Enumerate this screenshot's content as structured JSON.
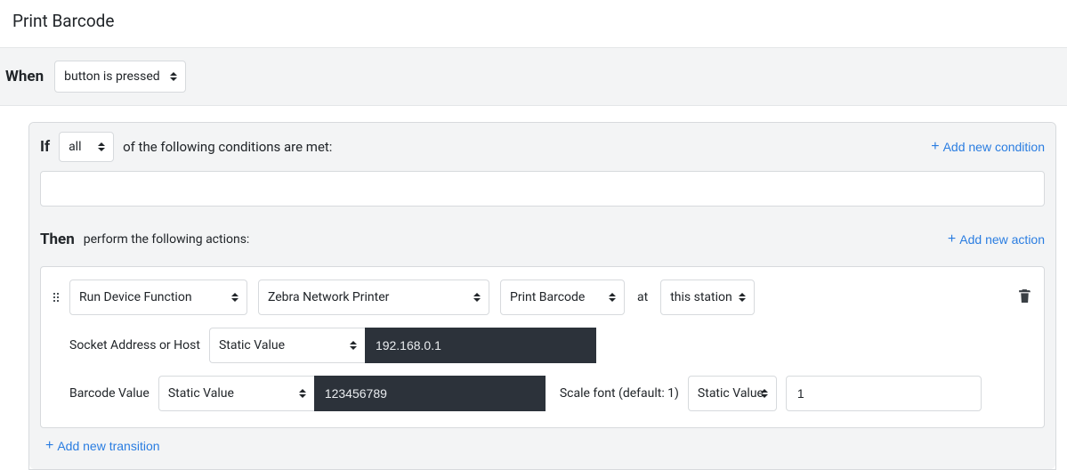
{
  "title": "Print Barcode",
  "when": {
    "label": "When",
    "trigger": "button is pressed"
  },
  "if": {
    "label": "If",
    "mode": "all",
    "suffix": "of the following conditions are met:",
    "add_label": "Add new condition"
  },
  "then": {
    "label": "Then",
    "suffix": "perform the following actions:",
    "add_label": "Add new action"
  },
  "action": {
    "type": "Run Device Function",
    "device": "Zebra Network Printer",
    "function": "Print Barcode",
    "at_label": "at",
    "station": "this station",
    "params": {
      "socket_label": "Socket Address or Host",
      "socket_mode": "Static Value",
      "socket_value": "192.168.0.1",
      "barcode_label": "Barcode Value",
      "barcode_mode": "Static Value",
      "barcode_value": "123456789",
      "scale_label": "Scale font (default: 1)",
      "scale_mode": "Static Value",
      "scale_value": "1"
    }
  },
  "add_transition_label": "Add new transition"
}
